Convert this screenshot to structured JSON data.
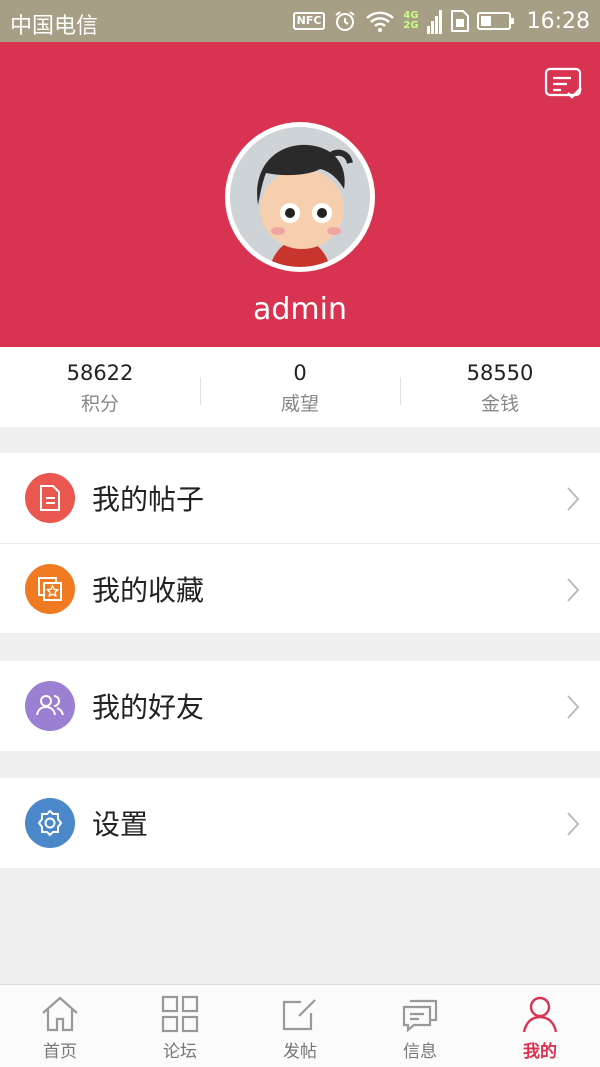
{
  "status_bar": {
    "carrier": "中国电信",
    "nfc": "NFC",
    "net_4g": "4G",
    "net_2g": "2G",
    "time": "16:28"
  },
  "profile": {
    "username": "admin"
  },
  "stats": [
    {
      "value": "58622",
      "label": "积分"
    },
    {
      "value": "0",
      "label": "威望"
    },
    {
      "value": "58550",
      "label": "金钱"
    }
  ],
  "menu": {
    "my_posts": "我的帖子",
    "my_favorites": "我的收藏",
    "my_friends": "我的好友",
    "settings": "设置"
  },
  "icon_colors": {
    "posts": "#e9574f",
    "favorites": "#f07a22",
    "friends": "#9a7fd2",
    "settings": "#4b88c9"
  },
  "accent": "#d83452",
  "tabs": [
    {
      "label": "首页",
      "icon": "home-icon"
    },
    {
      "label": "论坛",
      "icon": "grid-icon"
    },
    {
      "label": "发帖",
      "icon": "compose-icon"
    },
    {
      "label": "信息",
      "icon": "message-icon"
    },
    {
      "label": "我的",
      "icon": "person-icon",
      "active": true
    }
  ]
}
